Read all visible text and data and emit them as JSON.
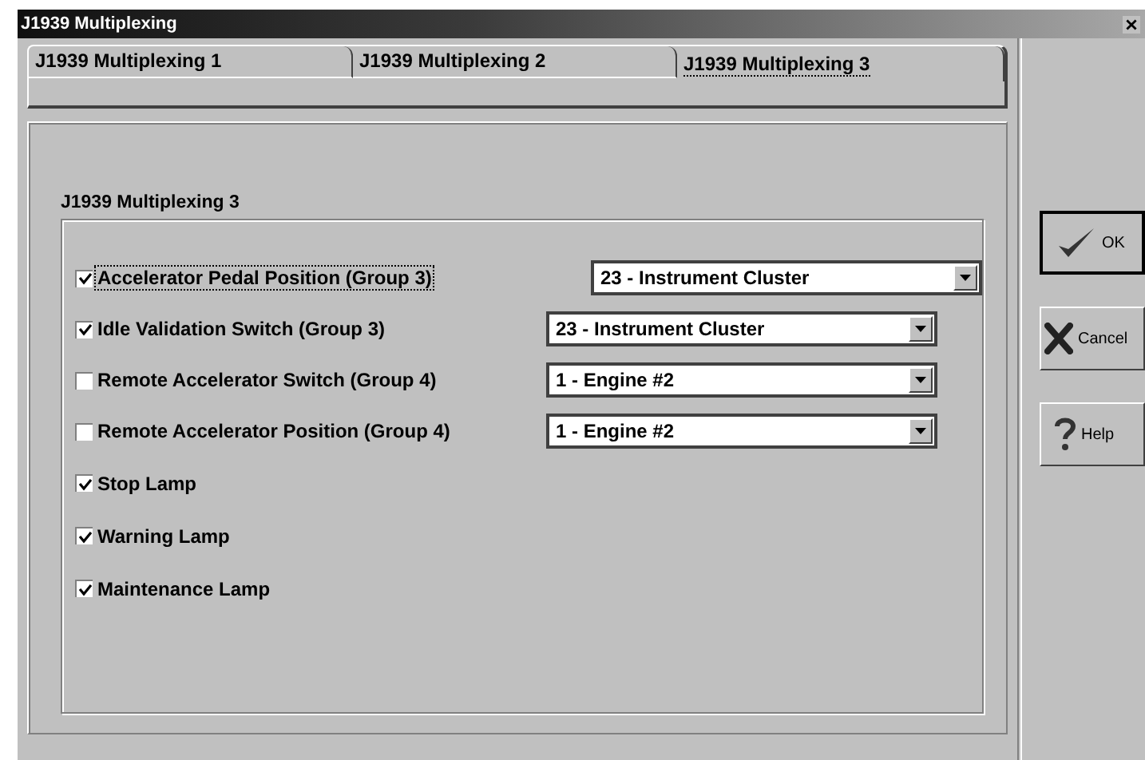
{
  "window": {
    "title": "J1939 Multiplexing"
  },
  "tabs": [
    {
      "label": "J1939 Multiplexing 1",
      "selected": false
    },
    {
      "label": "J1939 Multiplexing 2",
      "selected": false
    },
    {
      "label": "J1939 Multiplexing 3",
      "selected": true
    }
  ],
  "group": {
    "title": "J1939 Multiplexing 3"
  },
  "options": [
    {
      "label": "Accelerator Pedal Position (Group 3)",
      "checked": true,
      "focused": true,
      "dropdown": {
        "value": "23 - Instrument Cluster"
      }
    },
    {
      "label": "Idle Validation Switch (Group 3)",
      "checked": true,
      "focused": false,
      "dropdown": {
        "value": "23 - Instrument Cluster"
      }
    },
    {
      "label": "Remote Accelerator Switch (Group 4)",
      "checked": false,
      "focused": false,
      "dropdown": {
        "value": "1 - Engine #2"
      }
    },
    {
      "label": "Remote Accelerator Position (Group 4)",
      "checked": false,
      "focused": false,
      "dropdown": {
        "value": "1 - Engine #2"
      }
    },
    {
      "label": "Stop Lamp",
      "checked": true,
      "focused": false
    },
    {
      "label": "Warning Lamp",
      "checked": true,
      "focused": false
    },
    {
      "label": "Maintenance Lamp",
      "checked": true,
      "focused": false
    }
  ],
  "buttons": [
    {
      "label": "OK",
      "kind": "ok",
      "default": true
    },
    {
      "label": "Cancel",
      "kind": "cancel",
      "default": false
    },
    {
      "label": "Help",
      "kind": "help",
      "default": false
    }
  ]
}
